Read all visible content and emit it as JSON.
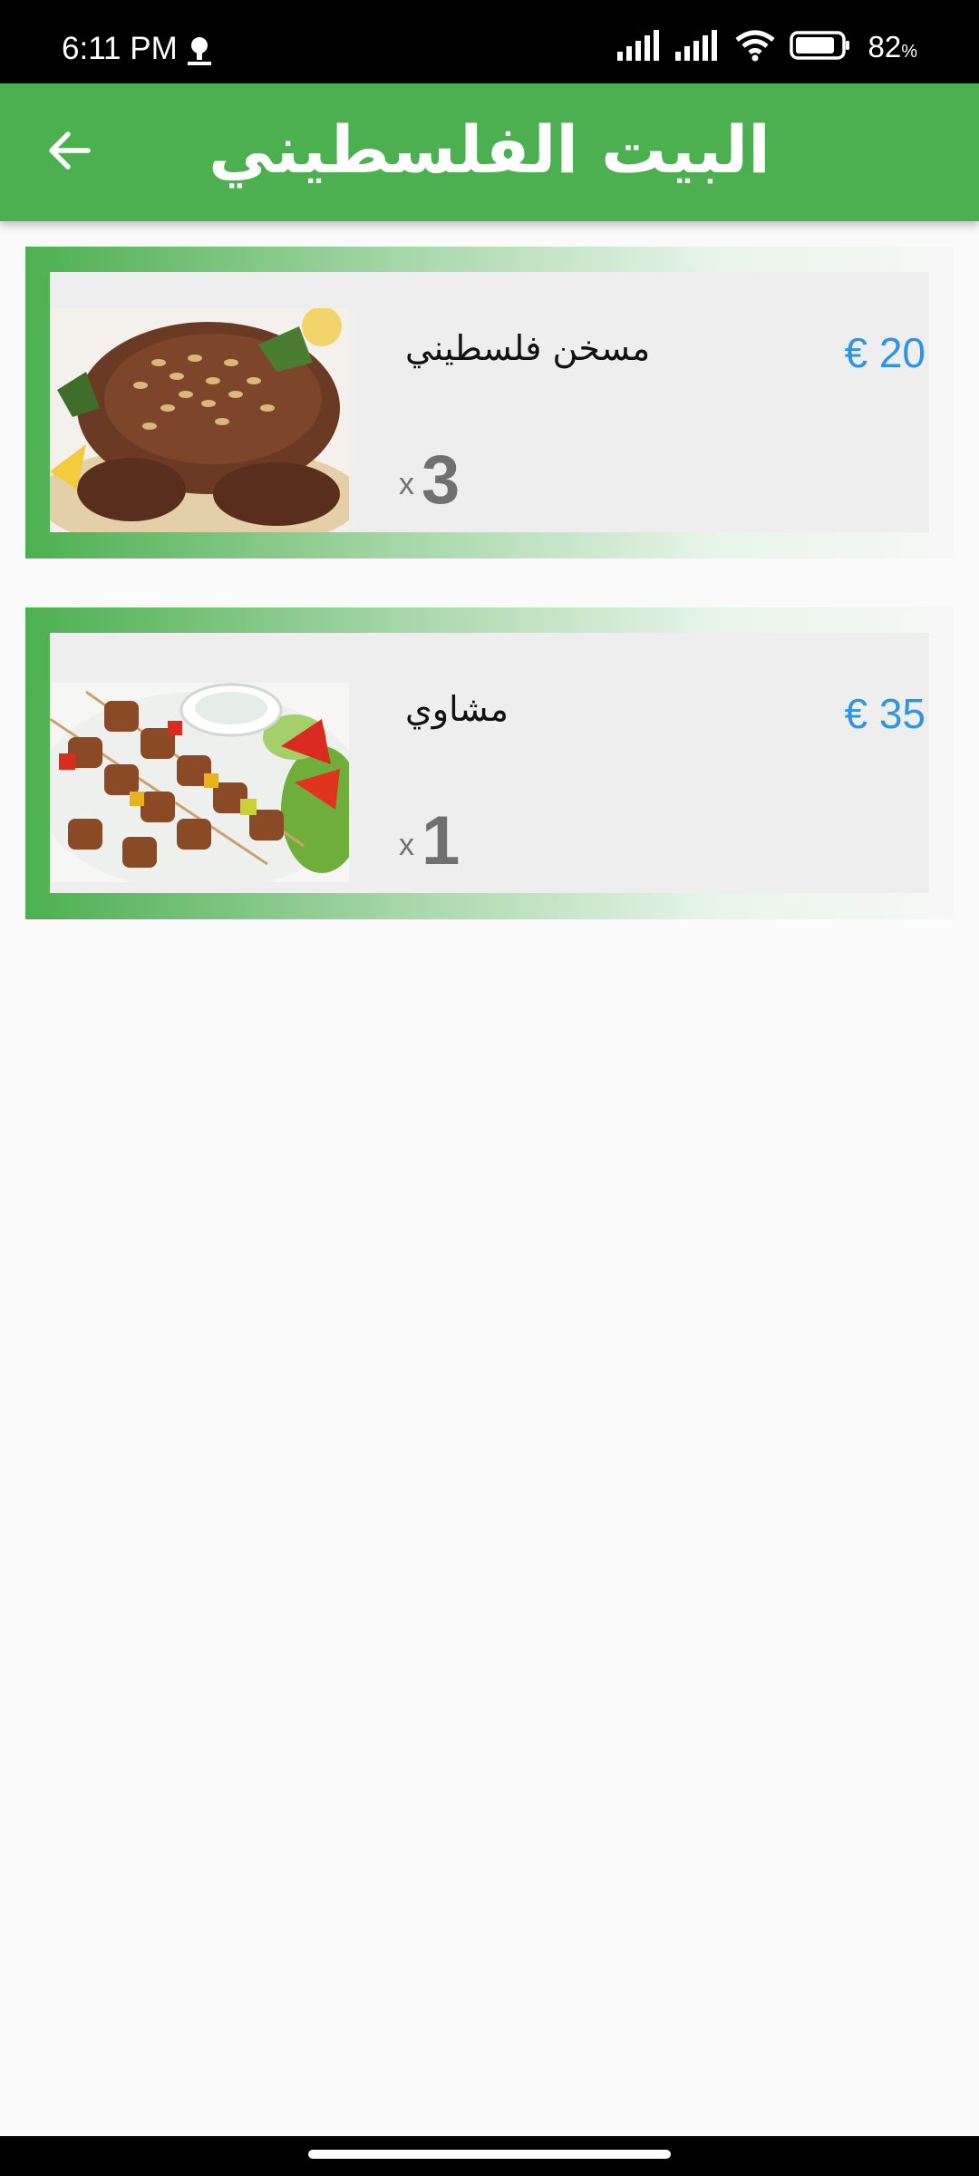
{
  "status_bar": {
    "time": "6:11 PM",
    "battery_percent": "82",
    "battery_unit": "%",
    "icons": [
      "notification-icon",
      "signal-icon",
      "signal-icon",
      "wifi-icon",
      "battery-icon"
    ]
  },
  "app_bar": {
    "title": "البيت الفلسطيني",
    "back_icon": "arrow-left-icon"
  },
  "orders": [
    {
      "name": "مسخن فلسطيني",
      "price": "€ 20",
      "qty_prefix": "x",
      "qty": "3",
      "image": "musakhan-food-image"
    },
    {
      "name": "مشاوي",
      "price": "€ 35",
      "qty_prefix": "x",
      "qty": "1",
      "image": "grilled-skewers-food-image"
    }
  ],
  "colors": {
    "primary": "#4cb050",
    "price": "#2f95e0",
    "card_bg": "#eeeeee",
    "qty": "#707070"
  }
}
